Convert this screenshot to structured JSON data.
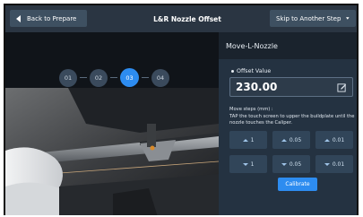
{
  "header": {
    "back_label": "Back to Prepare",
    "title": "L&R Nozzle Offset",
    "skip_label": "Skip to Another Step"
  },
  "steps": [
    "01",
    "02",
    "03",
    "04"
  ],
  "active_step": "03",
  "panel": {
    "title": "Move-L-Nozzle",
    "offset_label": "Offset Value",
    "offset_value": "230.00",
    "desc_line1": "Move steps (mm) :",
    "desc_line2": "TAP the touch screen to upper the buildplate until the nozzle touches the Caliper.",
    "up_buttons": [
      "1",
      "0.05",
      "0.01"
    ],
    "down_buttons": [
      "1",
      "0.05",
      "0.01"
    ],
    "calibrate_label": "Calibrate"
  },
  "colors": {
    "accent": "#2d8cf0",
    "topbar": "#2a3542",
    "panel": "#243241"
  }
}
